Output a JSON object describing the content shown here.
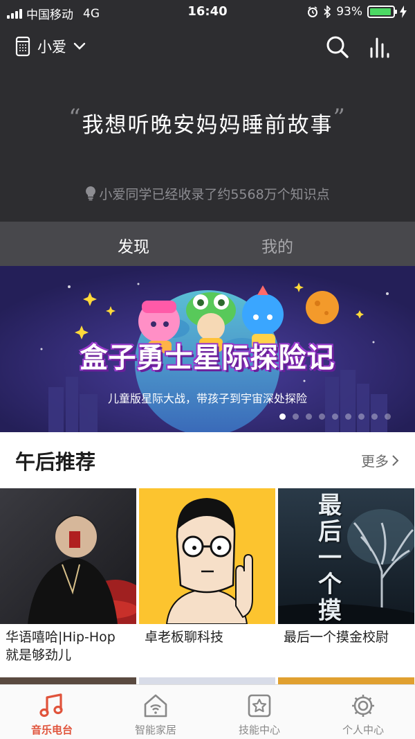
{
  "status_bar": {
    "carrier": "中国移动",
    "network": "4G",
    "time": "16:40",
    "battery": "93%",
    "battery_level": 0.93
  },
  "header": {
    "device_name": "小爱",
    "quote_open": "“",
    "quote": "我想听晚安妈妈睡前故事",
    "quote_close": "”",
    "hint": "小爱同学已经收录了约5568万个知识点"
  },
  "tabs": [
    {
      "label": "发现",
      "active": true
    },
    {
      "label": "我的",
      "active": false
    }
  ],
  "banner": {
    "title": "盒子勇士星际探险记",
    "subtitle": "儿童版星际大战，带孩子到宇宙深处探险",
    "dots_total": 9,
    "dots_active": 0
  },
  "section": {
    "title": "午后推荐",
    "more": "更多"
  },
  "cards": [
    {
      "line1": "华语嘻哈|Hip-Hop",
      "line2": "就是够劲儿"
    },
    {
      "line1": "卓老板聊科技",
      "line2": ""
    },
    {
      "line1": "最后一个摸金校尉",
      "line2": ""
    }
  ],
  "cover_art": {
    "card3_cover_text": "最后一个摸金校尉"
  },
  "bottom_tabs": [
    {
      "label": "音乐电台",
      "icon": "music-note-icon",
      "active": true
    },
    {
      "label": "智能家居",
      "icon": "smart-home-icon",
      "active": false
    },
    {
      "label": "技能中心",
      "icon": "skill-star-icon",
      "active": false
    },
    {
      "label": "个人中心",
      "icon": "settings-gear-icon",
      "active": false
    }
  ],
  "colors": {
    "header_bg": "#2d2d30",
    "tabs_bg": "#48484c",
    "accent": "#e0533b",
    "battery": "#4cd964",
    "banner_bg": "#27235e"
  }
}
